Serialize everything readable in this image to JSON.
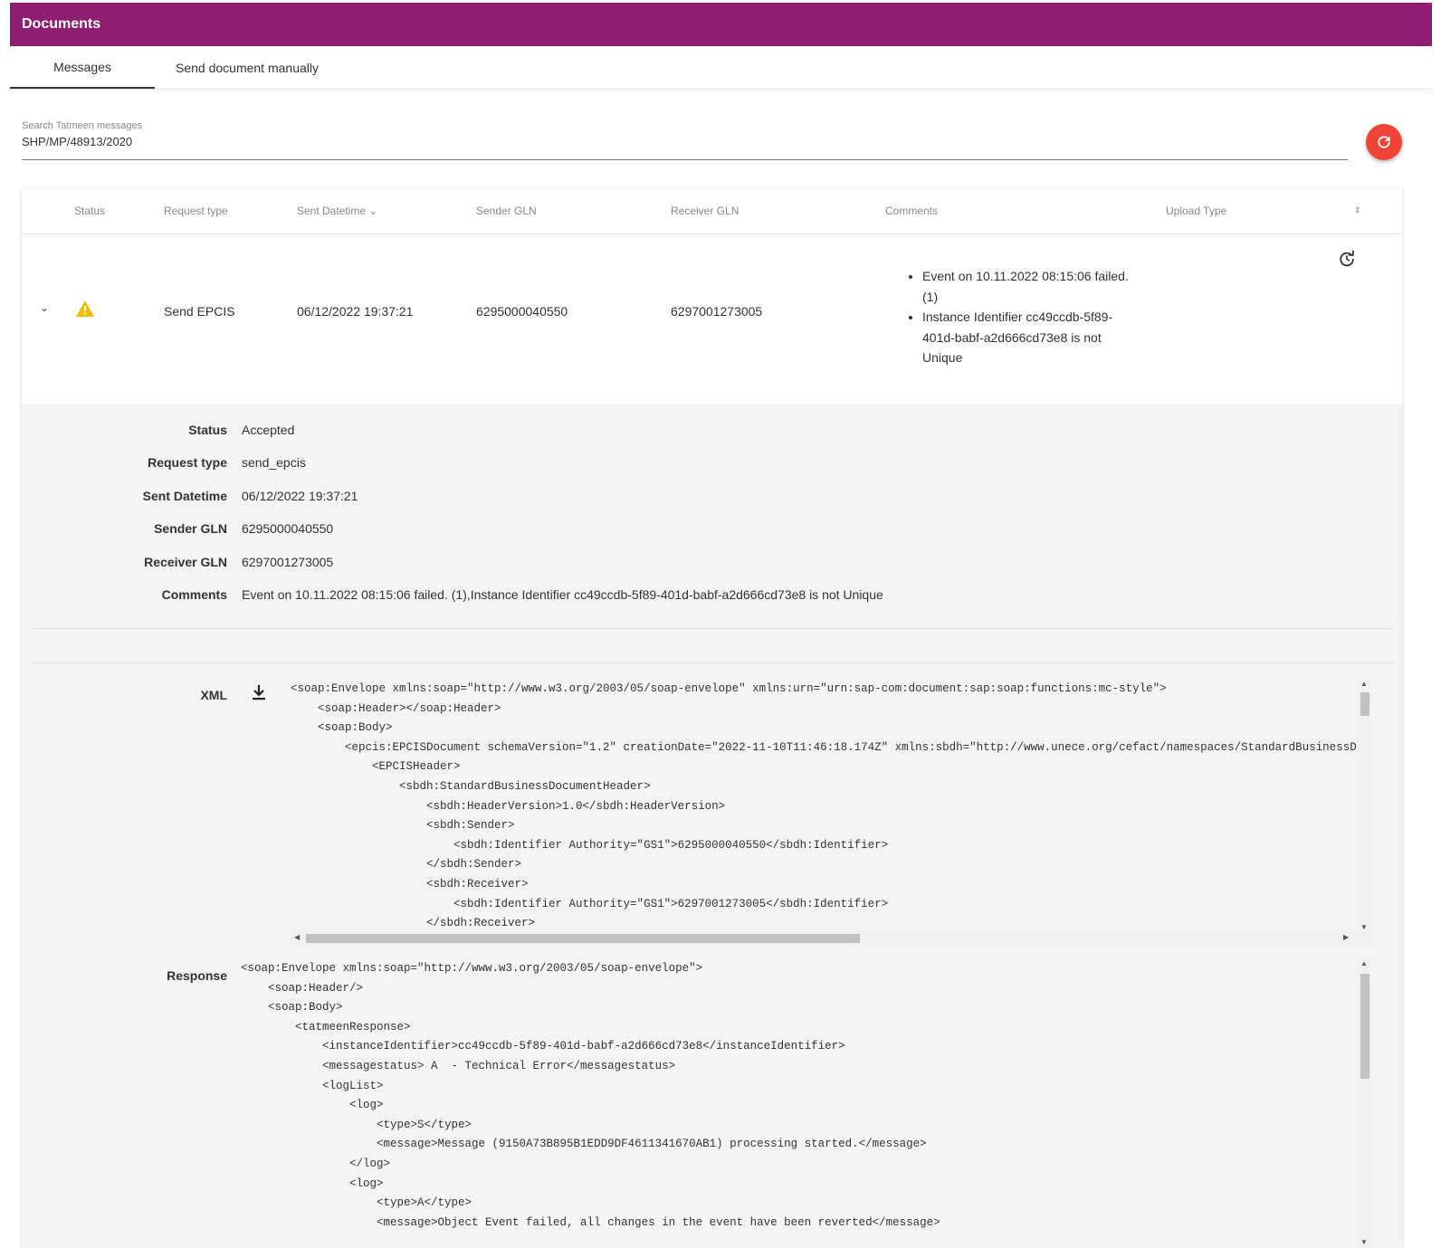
{
  "header": {
    "title": "Documents"
  },
  "tabs": [
    {
      "label": "Messages"
    },
    {
      "label": "Send document manually"
    }
  ],
  "search": {
    "label": "Search Tatmeen messages",
    "value": "SHP/MP/48913/2020"
  },
  "colors": {
    "brand": "#8e1e72",
    "fab": "#f04438",
    "warning": "#f0c000"
  },
  "table": {
    "headers": {
      "status": "Status",
      "request_type": "Request type",
      "sent": "Sent Datetime",
      "sender": "Sender GLN",
      "receiver": "Receiver GLN",
      "comments": "Comments",
      "upload": "Upload Type"
    },
    "row": {
      "request_type": "Send EPCIS",
      "sent": "06/12/2022 19:37:21",
      "sender": "6295000040550",
      "receiver": "6297001273005",
      "comments": [
        "Event on 10.11.2022 08:15:06 failed. (1)",
        "Instance Identifier cc49ccdb-5f89-401d-babf-a2d666cd73e8 is not Unique"
      ]
    }
  },
  "detail": {
    "fields": [
      {
        "k": "Status",
        "v": "Accepted"
      },
      {
        "k": "Request type",
        "v": "send_epcis"
      },
      {
        "k": "Sent Datetime",
        "v": "06/12/2022 19:37:21"
      },
      {
        "k": "Sender GLN",
        "v": "6295000040550"
      },
      {
        "k": "Receiver GLN",
        "v": "6297001273005"
      },
      {
        "k": "Comments",
        "v": "Event on 10.11.2022 08:15:06 failed. (1),Instance Identifier cc49ccdb-5f89-401d-babf-a2d666cd73e8 is not Unique"
      }
    ],
    "xml_label": "XML",
    "response_label": "Response",
    "xml": "<soap:Envelope xmlns:soap=\"http://www.w3.org/2003/05/soap-envelope\" xmlns:urn=\"urn:sap-com:document:sap:soap:functions:mc-style\">\n    <soap:Header></soap:Header>\n    <soap:Body>\n        <epcis:EPCISDocument schemaVersion=\"1.2\" creationDate=\"2022-11-10T11:46:18.174Z\" xmlns:sbdh=\"http://www.unece.org/cefact/namespaces/StandardBusinessDocumentHeader\">\n            <EPCISHeader>\n                <sbdh:StandardBusinessDocumentHeader>\n                    <sbdh:HeaderVersion>1.0</sbdh:HeaderVersion>\n                    <sbdh:Sender>\n                        <sbdh:Identifier Authority=\"GS1\">6295000040550</sbdh:Identifier>\n                    </sbdh:Sender>\n                    <sbdh:Receiver>\n                        <sbdh:Identifier Authority=\"GS1\">6297001273005</sbdh:Identifier>\n                    </sbdh:Receiver>",
    "response": "<soap:Envelope xmlns:soap=\"http://www.w3.org/2003/05/soap-envelope\">\n    <soap:Header/>\n    <soap:Body>\n        <tatmeenResponse>\n            <instanceIdentifier>cc49ccdb-5f89-401d-babf-a2d666cd73e8</instanceIdentifier>\n            <messagestatus> A  - Technical Error</messagestatus>\n            <logList>\n                <log>\n                    <type>S</type>\n                    <message>Message (9150A73B895B1EDD9DF4611341670AB1) processing started.</message>\n                </log>\n                <log>\n                    <type>A</type>\n                    <message>Object Event failed, all changes in the event have been reverted</message>"
  }
}
